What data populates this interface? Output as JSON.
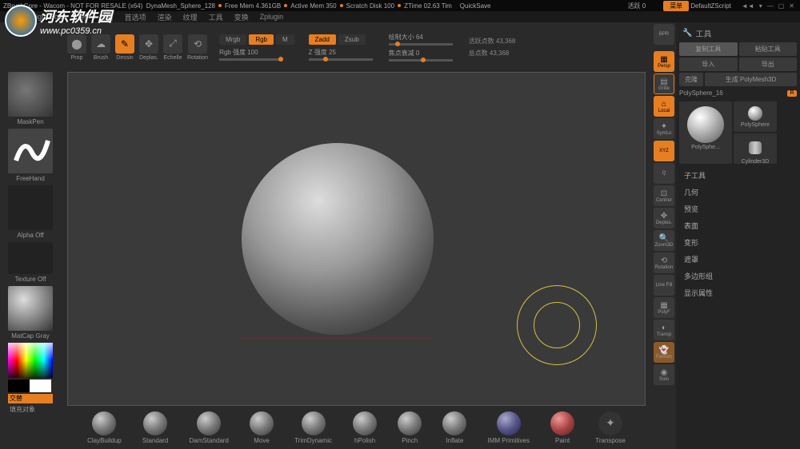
{
  "watermark": {
    "title": "河东软件园",
    "url": "www.pc0359.cn"
  },
  "titlebar": {
    "app": "ZBrushCore - Wacom - NOT FOR RESALE (x64)",
    "doc": "DynaMesh_Sphere_128",
    "freemem": "Free Mem 4.361GB",
    "activemem": "Active Mem 350",
    "scratch": "Scratch Disk 100",
    "ztime": "ZTime 02.63 Tim",
    "quicksave": "QuickSave",
    "active": "活跃 0",
    "menu_btn": "菜单",
    "script": "DefaultZScript"
  },
  "menu": [
    "首页",
    "Light Box",
    "灯光",
    "材质",
    "首选项",
    "渲染",
    "纹理",
    "工具",
    "变换",
    "Zplugin"
  ],
  "left": {
    "maskpen": "MaskPen",
    "freehand": "FreeHand",
    "alpha": "Alpha Off",
    "texture": "Texture Off",
    "matcap": "MatCap Gray",
    "jiaocha": "交替",
    "fill": "填充对象"
  },
  "toolbar": {
    "btns": [
      "Prop",
      "Brush",
      "Dessin",
      "Deplas.",
      "Echelle",
      "Rotation"
    ],
    "mrgb": "Mrgb",
    "rgb": "Rgb",
    "m": "M",
    "zadd": "Zadd",
    "zsub": "Zsub",
    "rgb_label": "Rgb 强度 100",
    "z_label": "Z 强度 25",
    "draw_size": "绘制大小 64",
    "focal": "焦点衰减 0",
    "active_pts": "活跃点数 43,368",
    "total_pts": "总点数 43,368"
  },
  "right_tools": [
    "BPR",
    "Persp",
    "Grille",
    "Local",
    "SymLo",
    "XYZ",
    "Q",
    "Centrer",
    "Deplas.",
    "Zoom3D",
    "Rotation",
    "Line Fill",
    "PolyF",
    "Transp",
    "Fantom",
    "Solo"
  ],
  "panel": {
    "title": "工具",
    "copy": "复制工具",
    "paste": "粘贴工具",
    "import": "导入",
    "export": "导出",
    "clone": "克隆",
    "polymesh": "生成 PolyMesh3D",
    "polysphere": "PolySphere_16",
    "r": "R",
    "tool1": "PolySphe...",
    "tool2": "PolySphere",
    "tool3": "Cylinder3D",
    "sections": [
      "子工具",
      "几何",
      "预览",
      "表面",
      "变形",
      "遮罩",
      "多边形组",
      "显示属性"
    ]
  },
  "brushes": [
    "ClayBuildup",
    "Standard",
    "DamStandard",
    "Move",
    "TrimDynamic",
    "hPolish",
    "Pinch",
    "Inflate",
    "IMM Primitives",
    "Paint",
    "Transpose"
  ]
}
